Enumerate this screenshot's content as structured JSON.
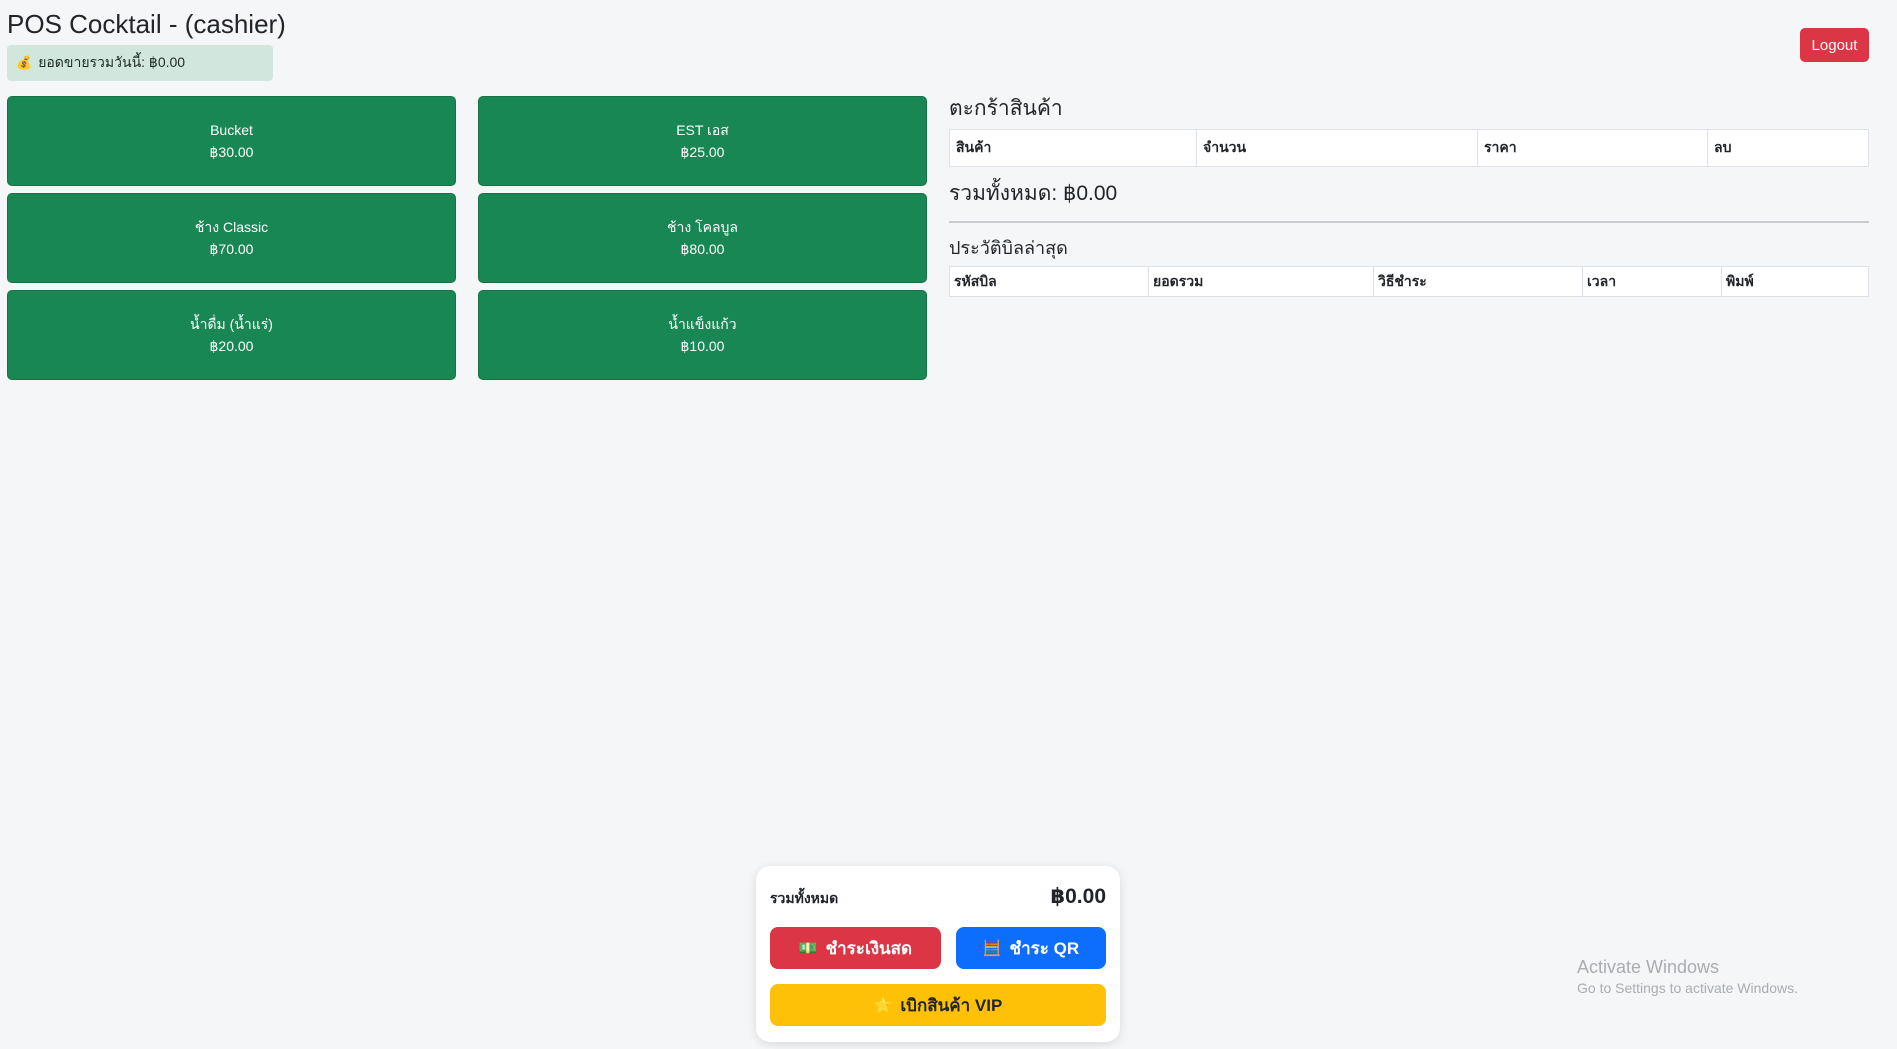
{
  "header": {
    "title": "POS Cocktail - (cashier)",
    "sales_today_icon": "money-bag-icon",
    "sales_today": "ยอดขายรวมวันนี้: ฿0.00",
    "logout_label": "Logout"
  },
  "products": [
    {
      "name": "Bucket",
      "price": "฿30.00"
    },
    {
      "name": "EST เอส",
      "price": "฿25.00"
    },
    {
      "name": "ช้าง Classic",
      "price": "฿70.00"
    },
    {
      "name": "ช้าง โคลบูล",
      "price": "฿80.00"
    },
    {
      "name": "น้ำดื่ม (น้ำแร่)",
      "price": "฿20.00"
    },
    {
      "name": "น้ำแข็งแก้ว",
      "price": "฿10.00"
    }
  ],
  "cart": {
    "title": "ตะกร้าสินค้า",
    "columns": [
      "สินค้า",
      "จำนวน",
      "ราคา",
      "ลบ"
    ],
    "total": "รวมทั้งหมด: ฿0.00"
  },
  "history": {
    "title": "ประวัติบิลล่าสุด",
    "columns": [
      "รหัสบิล",
      "ยอดรวม",
      "วิธีชำระ",
      "เวลา",
      "พิมพ์"
    ]
  },
  "checkout": {
    "total_label": "รวมทั้งหมด",
    "total_value": "฿0.00",
    "cash_label": "ชำระเงินสด",
    "cash_icon": "cash-icon",
    "qr_label": "ชำระ QR",
    "qr_icon": "qr-icon",
    "vip_label": "เบิกสินค้า VIP",
    "vip_icon": "star-icon"
  },
  "watermark": {
    "line1": "Activate Windows",
    "line2": "Go to Settings to activate Windows."
  }
}
